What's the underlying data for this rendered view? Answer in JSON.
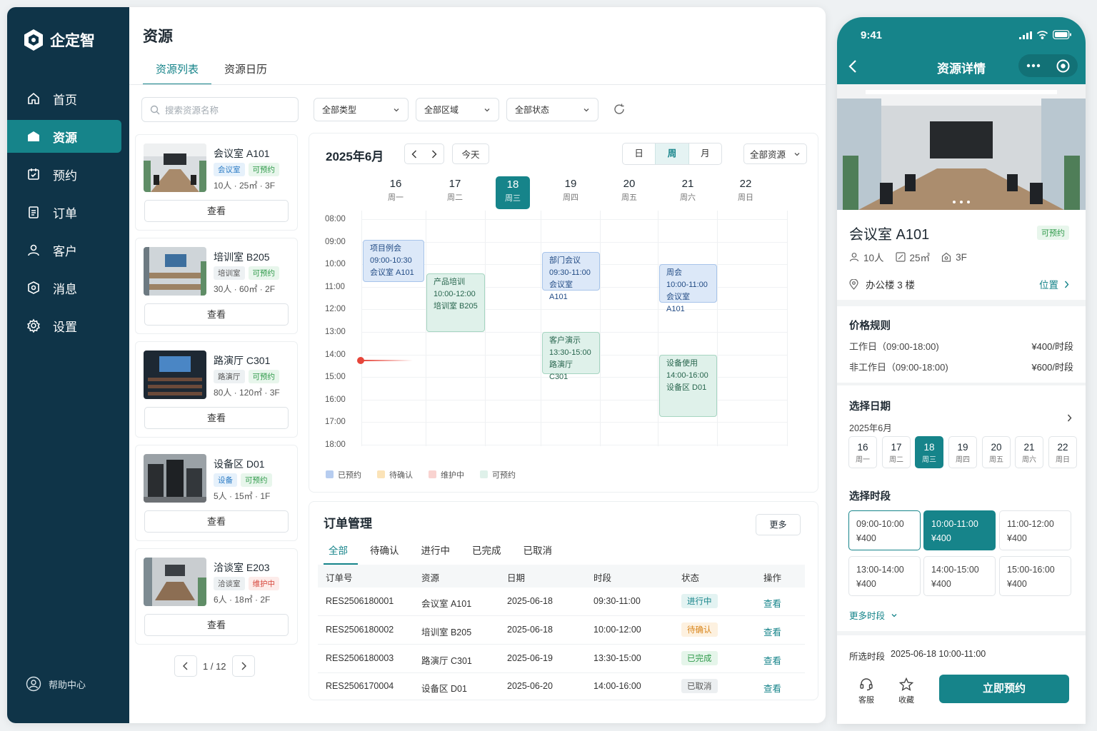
{
  "app": {
    "logo_text": "企定智",
    "brand_color": "#16848a",
    "sidebar_color": "#0f3448"
  },
  "sidebar": {
    "items": [
      {
        "label": "首页",
        "icon": "home-icon"
      },
      {
        "label": "资源",
        "icon": "resource-icon",
        "active": true
      },
      {
        "label": "预约",
        "icon": "calendar-check-icon"
      },
      {
        "label": "订单",
        "icon": "order-icon"
      },
      {
        "label": "客户",
        "icon": "user-icon"
      },
      {
        "label": "消息",
        "icon": "message-icon"
      },
      {
        "label": "设置",
        "icon": "gear-icon"
      }
    ],
    "help": "帮助中心"
  },
  "header": {
    "title": "资源",
    "tabs": [
      "资源列表",
      "资源日历"
    ]
  },
  "filters": {
    "search_placeholder": "搜索资源名称",
    "type": "全部类型",
    "area": "全部区域",
    "status": "全部状态"
  },
  "resources": [
    {
      "name": "会议室 A101",
      "type": "会议室",
      "status": "可预约",
      "meta": "10人 · 25㎡ · 3F",
      "action": "查看"
    },
    {
      "name": "培训室 B205",
      "type": "培训室",
      "status": "可预约",
      "meta": "30人 · 60㎡ · 2F",
      "action": "查看"
    },
    {
      "name": "路演厅 C301",
      "type": "路演厅",
      "status": "可预约",
      "meta": "80人 · 120㎡ · 3F",
      "action": "查看"
    },
    {
      "name": "设备区 D01",
      "type": "设备",
      "status": "可预约",
      "meta": "5人 · 15㎡ · 1F",
      "action": "查看"
    },
    {
      "name": "洽谈室 E203",
      "type": "洽谈室",
      "status": "维护中",
      "meta": "6人 · 18㎡ · 2F",
      "action": "查看"
    }
  ],
  "pager": {
    "text": "1 / 12"
  },
  "calendar": {
    "title": "2025年6月",
    "today_btn": "今天",
    "views": [
      "日",
      "周",
      "月"
    ],
    "resource_filter": "全部资源",
    "days": [
      {
        "n": "16",
        "w": "周一"
      },
      {
        "n": "17",
        "w": "周二"
      },
      {
        "n": "18",
        "w": "周三",
        "today": true
      },
      {
        "n": "19",
        "w": "周四"
      },
      {
        "n": "20",
        "w": "周五"
      },
      {
        "n": "21",
        "w": "周六"
      },
      {
        "n": "22",
        "w": "周日"
      }
    ],
    "hours": [
      "08:00",
      "09:00",
      "10:00",
      "11:00",
      "12:00",
      "13:00",
      "14:00",
      "15:00",
      "16:00",
      "17:00",
      "18:00"
    ],
    "events": [
      {
        "title": "项目例会",
        "time": "09:00-10:30",
        "place": "会议室 A101",
        "color": "blue"
      },
      {
        "title": "产品培训",
        "time": "10:00-12:00",
        "place": "培训室 B205",
        "color": "green"
      },
      {
        "title": "部门会议",
        "time": "09:30-11:00",
        "place": "会议室 A101",
        "color": "blue"
      },
      {
        "title": "客户演示",
        "time": "13:30-15:00",
        "place": "路演厅 C301",
        "color": "green"
      },
      {
        "title": "周会",
        "time": "10:00-11:00",
        "place": "会议室 A101",
        "color": "blue"
      },
      {
        "title": "设备使用",
        "time": "14:00-16:00",
        "place": "设备区 D01",
        "color": "green"
      }
    ],
    "legend": [
      {
        "label": "已预约",
        "color": "#b7cdf0"
      },
      {
        "label": "待确认",
        "color": "#fbe3b8"
      },
      {
        "label": "维护中",
        "color": "#f9d3d0"
      },
      {
        "label": "可预约",
        "color": "#dff1ea"
      }
    ]
  },
  "orders": {
    "title": "订单管理",
    "more": "更多",
    "tabs": [
      "全部",
      "待确认",
      "进行中",
      "已完成",
      "已取消"
    ],
    "columns": [
      "订单号",
      "资源",
      "日期",
      "时段",
      "状态",
      "操作"
    ],
    "rows": [
      {
        "id": "RES2506180001",
        "resource": "会议室 A101",
        "date": "2025-06-18",
        "time": "09:30-11:00",
        "status": "进行中",
        "action": "查看"
      },
      {
        "id": "RES2506180002",
        "resource": "培训室 B205",
        "date": "2025-06-18",
        "time": "10:00-12:00",
        "status": "待确认",
        "action": "查看"
      },
      {
        "id": "RES2506180003",
        "resource": "路演厅 C301",
        "date": "2025-06-19",
        "time": "13:30-15:00",
        "status": "已完成",
        "action": "查看"
      },
      {
        "id": "RES2506170004",
        "resource": "设备区 D01",
        "date": "2025-06-20",
        "time": "14:00-16:00",
        "status": "已取消",
        "action": "查看"
      }
    ]
  },
  "phone": {
    "time": "9:41",
    "title": "资源详情",
    "name": "会议室 A101",
    "status": "可预约",
    "capacity": "10人",
    "area": "25㎡",
    "floor": "3F",
    "location": "办公楼 3 楼",
    "location_link": "位置",
    "price_title": "价格规则",
    "prices": [
      {
        "label": "工作日（09:00-18:00)",
        "value": "¥400/时段"
      },
      {
        "label": "非工作日（09:00-18:00)",
        "value": "¥600/时段"
      }
    ],
    "date_title": "选择日期",
    "month": "2025年6月",
    "dates": [
      {
        "n": "16",
        "w": "周一"
      },
      {
        "n": "17",
        "w": "周二"
      },
      {
        "n": "18",
        "w": "周三",
        "selected": true
      },
      {
        "n": "19",
        "w": "周四"
      },
      {
        "n": "20",
        "w": "周五"
      },
      {
        "n": "21",
        "w": "周六"
      },
      {
        "n": "22",
        "w": "周日"
      }
    ],
    "slot_title": "选择时段",
    "slots": [
      {
        "time": "09:00-10:00",
        "price": "¥400"
      },
      {
        "time": "10:00-11:00",
        "price": "¥400",
        "selected": true
      },
      {
        "time": "11:00-12:00",
        "price": "¥400"
      },
      {
        "time": "13:00-14:00",
        "price": "¥400"
      },
      {
        "time": "14:00-15:00",
        "price": "¥400"
      },
      {
        "time": "15:00-16:00",
        "price": "¥400"
      }
    ],
    "more_slots": "更多时段",
    "selected_label": "所选时段",
    "selected_value": "2025-06-18  10:00-11:00",
    "service": "客服",
    "favorite": "收藏",
    "book_btn": "立即预约"
  }
}
